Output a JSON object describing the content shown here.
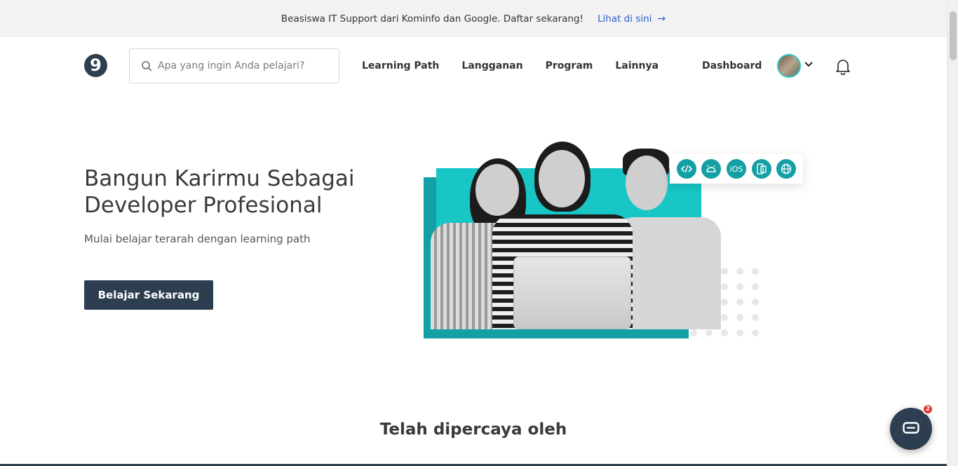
{
  "announcement": {
    "message": "Beasiswa IT Support dari Kominfo dan Google. Daftar sekarang!",
    "link_label": "Lihat di sini",
    "link_arrow": "→"
  },
  "header": {
    "logo_glyph": "9",
    "search": {
      "placeholder": "Apa yang ingin Anda pelajari?",
      "value": ""
    },
    "nav": [
      "Learning Path",
      "Langganan",
      "Program",
      "Lainnya"
    ],
    "dashboard_label": "Dashboard"
  },
  "hero": {
    "title": "Bangun Karirmu Sebagai Developer Profesional",
    "subtitle": "Mulai belajar terarah dengan learning path",
    "cta_label": "Belajar Sekarang",
    "platform_icons": [
      "web-code-icon",
      "android-icon",
      "ios-icon",
      "multiplatform-icon",
      "globe-icon"
    ],
    "ios_text": "iOS"
  },
  "trusted": {
    "heading": "Telah dipercaya oleh"
  },
  "chat": {
    "badge_count": "2"
  },
  "colors": {
    "accent": "#2d3e50",
    "teal": "#18c6c6",
    "link": "#2c5dcd",
    "badge": "#e0342a"
  }
}
